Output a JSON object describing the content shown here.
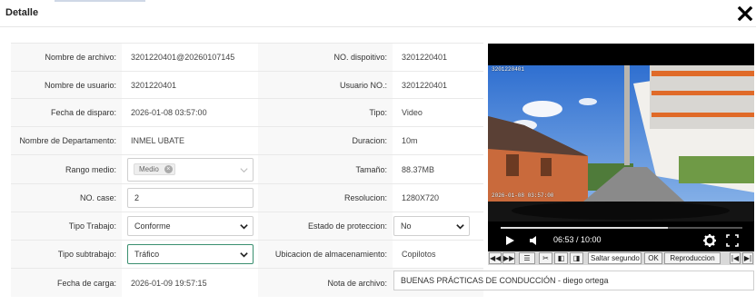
{
  "modal": {
    "title": "Detalle",
    "close_icon": "close-icon"
  },
  "fields": {
    "nombre_archivo": {
      "label": "Nombre de archivo:",
      "value": "3201220401@20260107145"
    },
    "no_dispositivo": {
      "label": "NO. dispoitivo:",
      "value": "3201220401"
    },
    "nombre_usuario": {
      "label": "Nombre de usuario:",
      "value": "3201220401"
    },
    "usuario_no": {
      "label": "Usuario NO.:",
      "value": "3201220401"
    },
    "fecha_disparo": {
      "label": "Fecha de disparo:",
      "value": "2026-01-08 03:57:00"
    },
    "tipo": {
      "label": "Tipo:",
      "value": "Video"
    },
    "departamento": {
      "label": "Nombre de Departamento:",
      "value": "INMEL UBATE"
    },
    "duracion": {
      "label": "Duracion:",
      "value": "10m"
    },
    "rango_medio": {
      "label": "Rango medio:",
      "chip": "Medio"
    },
    "tamano": {
      "label": "Tamaño:",
      "value": "88.37MB"
    },
    "no_case": {
      "label": "NO. case:",
      "value": "2"
    },
    "resolucion": {
      "label": "Resolucion:",
      "value": "1280X720"
    },
    "tipo_trabajo": {
      "label": "Tipo Trabajo:",
      "value": "Conforme"
    },
    "estado_proteccion": {
      "label": "Estado de proteccion:",
      "value": "No"
    },
    "tipo_subtrabajo": {
      "label": "Tipo subtrabajo:",
      "value": "Tráfico"
    },
    "ubicacion": {
      "label": "Ubicacion de almacenamiento:",
      "value": "Copilotos"
    },
    "fecha_carga": {
      "label": "Fecha de carga:",
      "value": "2026-01-09 19:57:15"
    },
    "nota_archivo": {
      "label": "Nota de archivo:",
      "value": "BUENAS PRÁCTICAS DE CONDUCCIÓN - diego ortega"
    }
  },
  "player": {
    "current_time": "06:53 / 10:00",
    "progress": 0.69,
    "osd_top": "3201220401",
    "osd_bottom": "2026-01-08 03:57:00"
  },
  "toolbar": {
    "skip_input": "Saltar segundo",
    "ok_label": "OK",
    "playback_label": "Reproduccion"
  },
  "colors": {
    "accent_border": "#3a8f6f",
    "panel_bg": "#f8f8f8",
    "player_bg": "#000000"
  }
}
